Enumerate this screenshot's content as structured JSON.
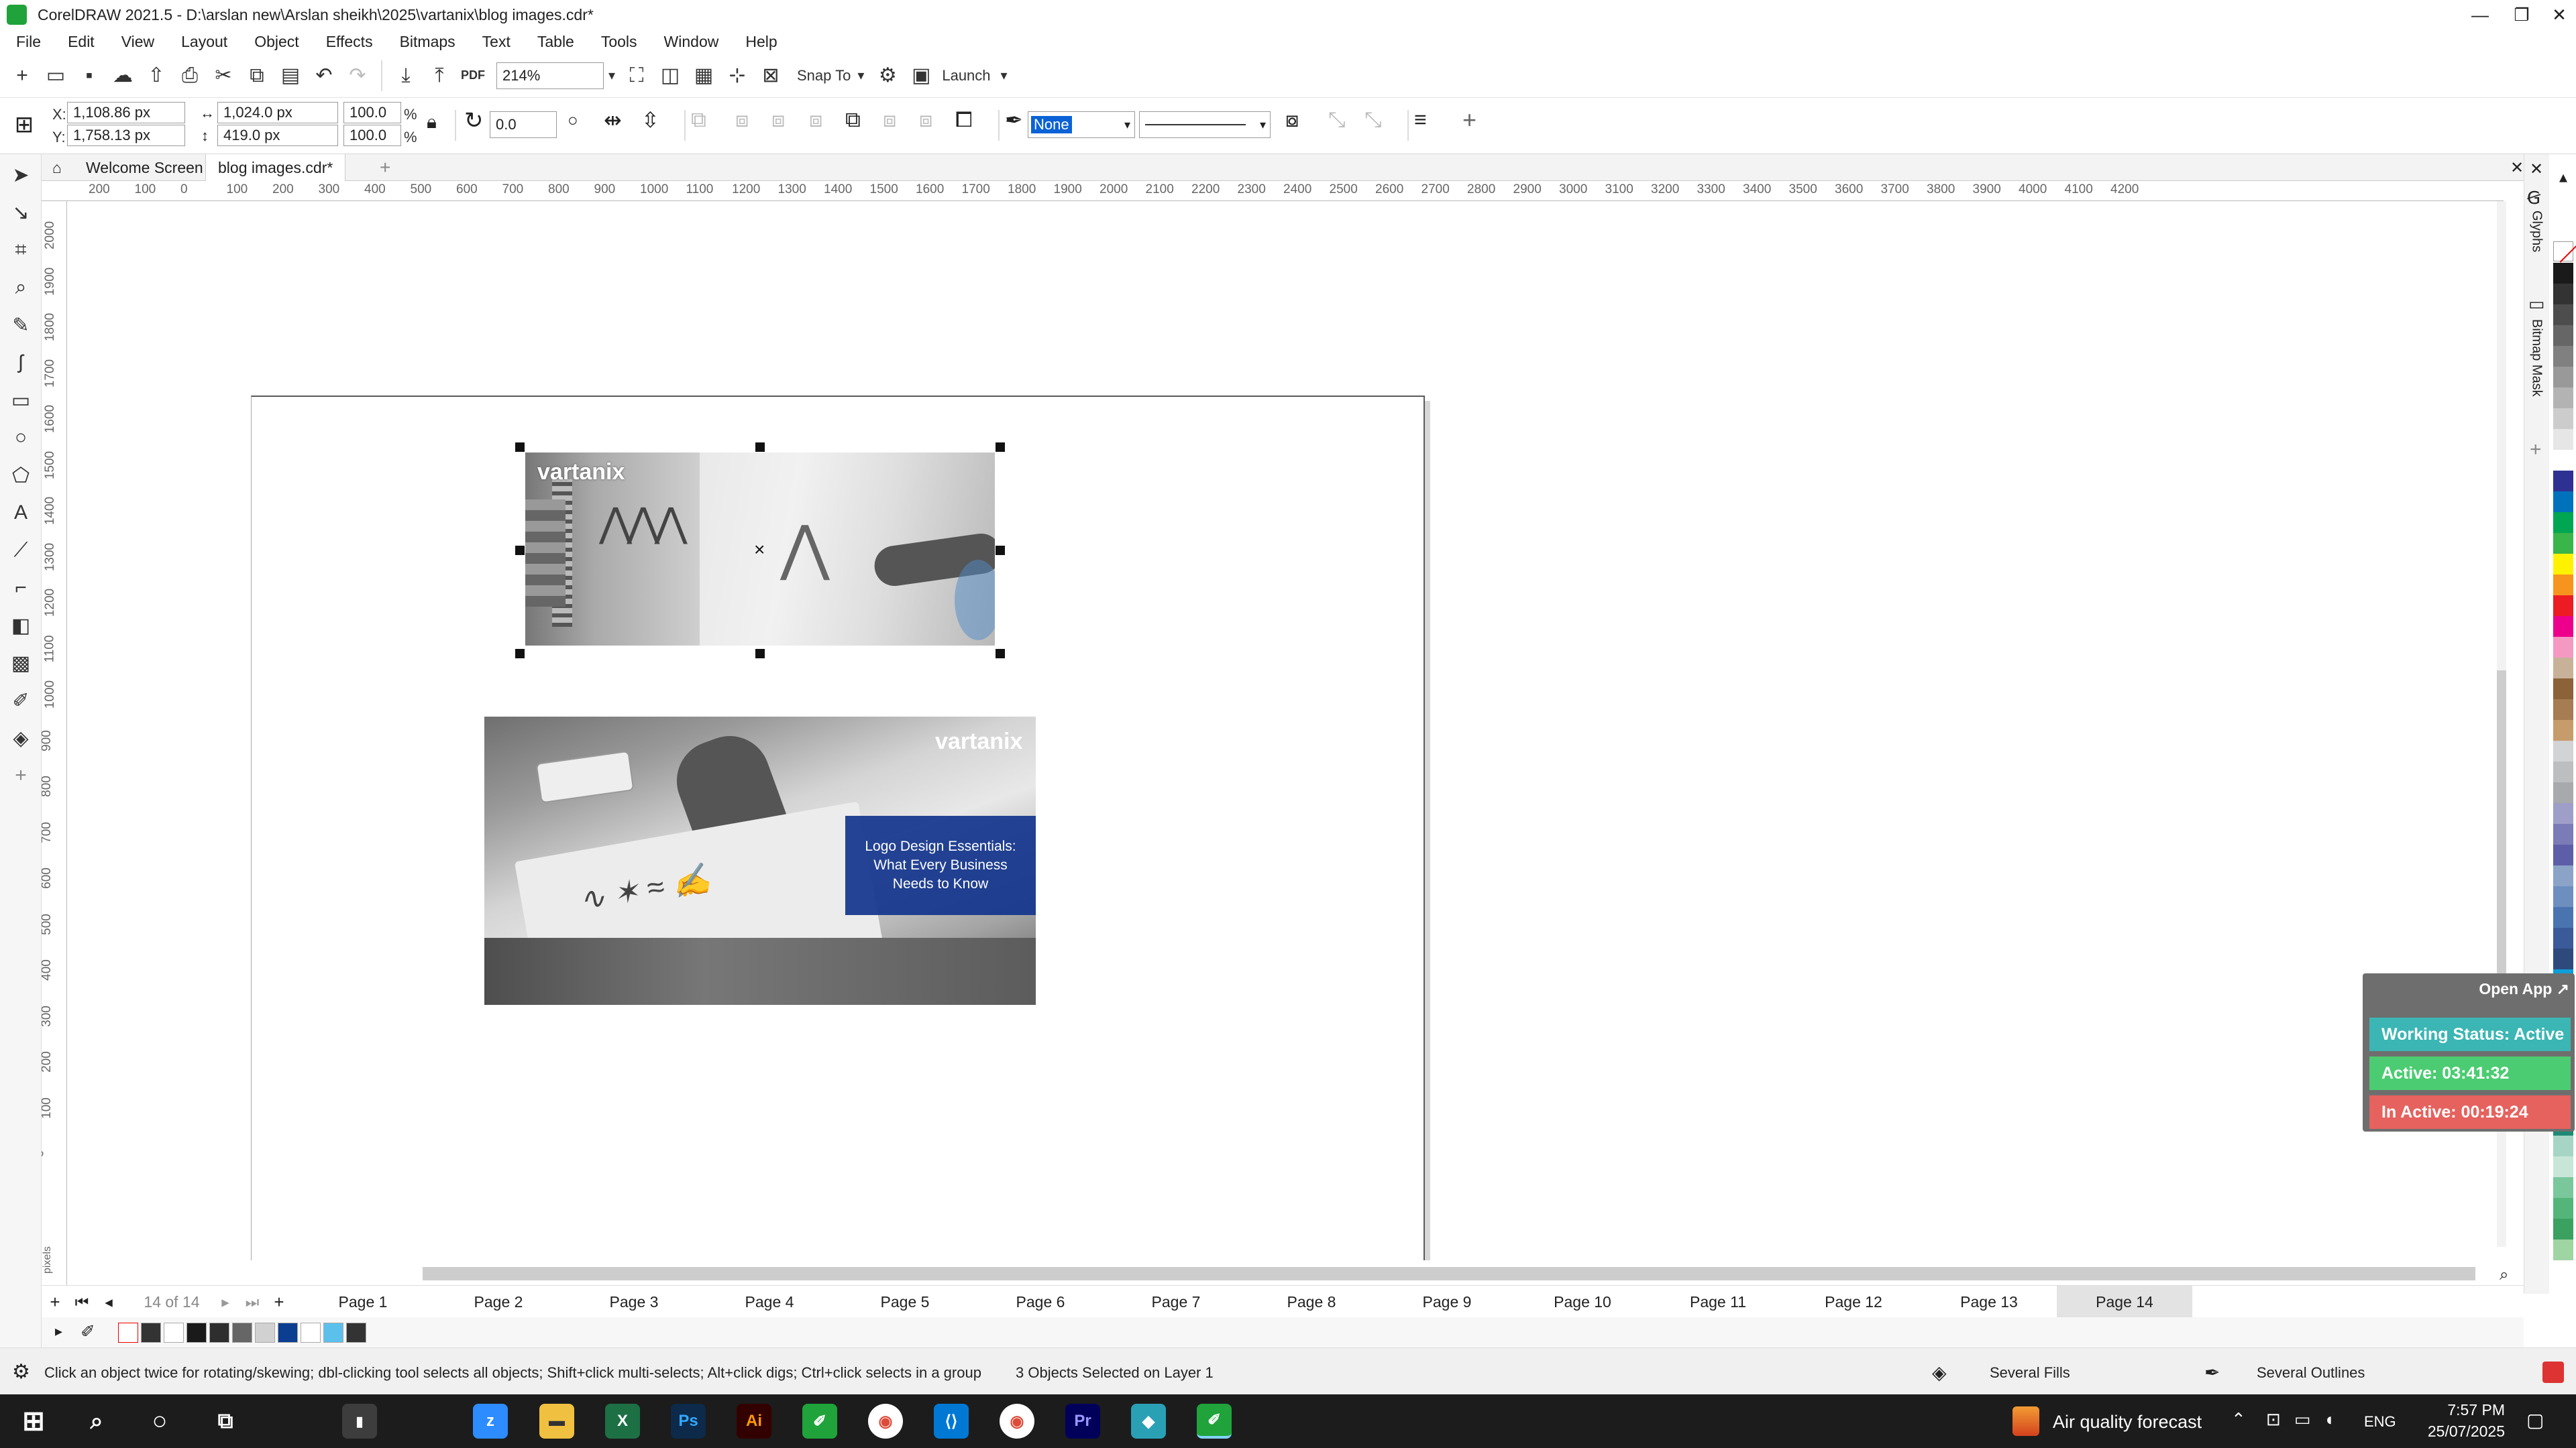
{
  "window": {
    "title": "CorelDRAW 2021.5 - D:\\arslan new\\Arslan sheikh\\2025\\vartanix\\blog images.cdr*",
    "minimize": "—",
    "maximize": "❐",
    "close": "✕"
  },
  "menu": [
    "File",
    "Edit",
    "View",
    "Layout",
    "Object",
    "Effects",
    "Bitmaps",
    "Text",
    "Table",
    "Tools",
    "Window",
    "Help"
  ],
  "toolbar": {
    "zoom": "214%",
    "snap_to": "Snap To",
    "launch": "Launch"
  },
  "properties": {
    "x_label": "X:",
    "x": "1,108.86 px",
    "y_label": "Y:",
    "y": "1,758.13 px",
    "width": "1,024.0 px",
    "height": "419.0 px",
    "scale_w": "100.0",
    "scale_h": "100.0",
    "percent": "%",
    "rotation": "0.0",
    "outline": "None"
  },
  "tabs": {
    "welcome": "Welcome Screen",
    "document": "blog images.cdr*"
  },
  "ruler": {
    "h_ticks": [
      "200",
      "100",
      "0",
      "100",
      "200",
      "300",
      "400",
      "500",
      "600",
      "700",
      "800",
      "900",
      "1000",
      "1100",
      "1200",
      "1300",
      "1400",
      "1500",
      "1600",
      "1700",
      "1800",
      "1900",
      "2000",
      "2100",
      "2200",
      "2300",
      "2400",
      "2500",
      "2600",
      "2700",
      "2800",
      "2900",
      "3000",
      "3100",
      "3200",
      "3300",
      "3400",
      "3500",
      "3600",
      "3700",
      "3800",
      "3900",
      "4000",
      "4100",
      "4200"
    ],
    "v_ticks": [
      "2000",
      "1900",
      "1800",
      "1700",
      "1600",
      "1500",
      "1400",
      "1300",
      "1200",
      "1100",
      "1000",
      "900",
      "800",
      "700",
      "600",
      "500",
      "400",
      "300",
      "200",
      "100",
      "0"
    ],
    "unit": "pixels"
  },
  "canvas": {
    "img1_brand": "vartanix",
    "img2_brand": "vartanix",
    "img2_headline": "Logo Design Essentials: What Every Business Needs to Know"
  },
  "dockers": {
    "glyphs": "Glyphs",
    "bitmap_mask": "Bitmap Mask"
  },
  "timer": {
    "open_app": "Open App ↗",
    "status": "Working Status: Active",
    "active": "Active: 03:41:32",
    "inactive": "In Active: 00:19:24"
  },
  "pager": {
    "counter": "14 of 14",
    "pages": [
      "Page 1",
      "Page 2",
      "Page 3",
      "Page 4",
      "Page 5",
      "Page 6",
      "Page 7",
      "Page 8",
      "Page 9",
      "Page 10",
      "Page 11",
      "Page 12",
      "Page 13",
      "Page 14"
    ]
  },
  "status": {
    "hint": "Click an object twice for rotating/skewing; dbl-clicking tool selects all objects; Shift+click multi-selects; Alt+click digs; Ctrl+click selects in a group",
    "selection": "3 Objects Selected on Layer 1",
    "fills": "Several Fills",
    "outlines": "Several Outlines"
  },
  "taskbar": {
    "weather": "Air quality forecast",
    "lang": "ENG",
    "time": "7:57 PM",
    "date": "25/07/2025"
  },
  "palette": [
    "#1a1a1a",
    "#333333",
    "#4d4d4d",
    "#666666",
    "#808080",
    "#999999",
    "#b3b3b3",
    "#cccccc",
    "#e6e6e6",
    "#ffffff",
    "#2e3192",
    "#0072bc",
    "#00a651",
    "#39b54a",
    "#fff200",
    "#f7941d",
    "#ed1c24",
    "#ec008c",
    "#f49ac2",
    "#c7b299",
    "#8c6239",
    "#a67c52",
    "#c69c6d",
    "#d1d3d4",
    "#bcbec0",
    "#a7a9ac",
    "#9e9ec8",
    "#7b7bb8",
    "#5d5da8",
    "#8ba3c7",
    "#6d8fbf",
    "#4a74b0",
    "#3b5a9a",
    "#2e4a7d",
    "#0e9fd8",
    "#57c4e5",
    "#8fd3e8",
    "#b7e4f0",
    "#74c7b8",
    "#4bb3a0",
    "#2e9e8a",
    "#1f8a75",
    "#a6d5c5",
    "#c8e6d7",
    "#7ac79b",
    "#54b57a",
    "#3aa160",
    "#9fd4a3"
  ],
  "strip": [
    "#1a1a1a",
    "#333333",
    "#ffffff",
    "#1a1a1a",
    "#2e2e2e",
    "#666666",
    "#d1d1d1",
    "#0b3d91",
    "#ffffff",
    "#5bc0eb",
    "#333333"
  ]
}
